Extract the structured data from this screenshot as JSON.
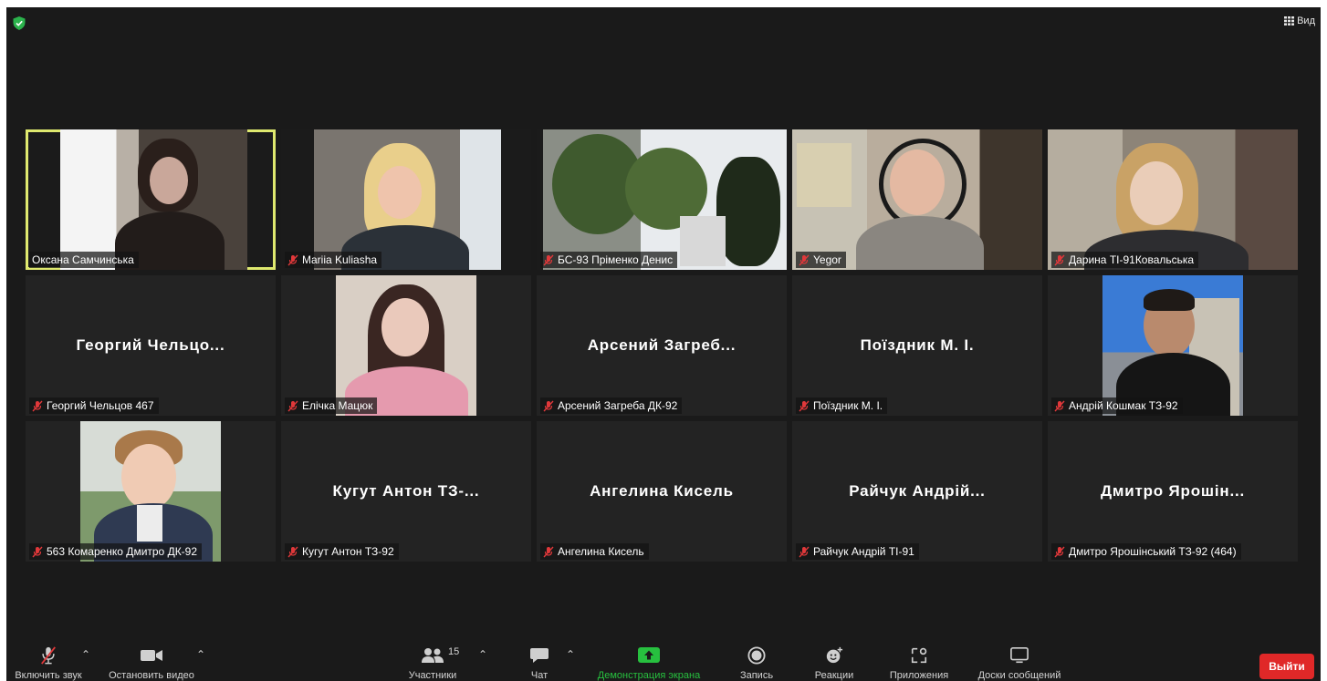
{
  "top": {
    "view_label": "Вид"
  },
  "tiles": [
    {
      "name": "Оксана Самчинська",
      "center": ""
    },
    {
      "name": "Mariia Kuliasha",
      "center": ""
    },
    {
      "name": "БС-93 Пріменко Денис",
      "center": ""
    },
    {
      "name": "Yegor",
      "center": ""
    },
    {
      "name": "Дарина ТІ-91Ковальська",
      "center": ""
    },
    {
      "name": "Георгий Чельцов 467",
      "center": "Георгий Чельцо..."
    },
    {
      "name": "Елічка Мацюк",
      "center": ""
    },
    {
      "name": "Арсений Загреба ДК-92",
      "center": "Арсений Загреб..."
    },
    {
      "name": "Поїздник М. І.",
      "center": "Поїздник М. І."
    },
    {
      "name": "Андрій Кошмак ТЗ-92",
      "center": ""
    },
    {
      "name": "563 Комаренко Дмитро ДК-92",
      "center": ""
    },
    {
      "name": "Кугут Антон ТЗ-92",
      "center": "Кугут Антон ТЗ-..."
    },
    {
      "name": "Ангелина Кисель",
      "center": "Ангелина Кисель"
    },
    {
      "name": "Райчук Андрій ТІ-91",
      "center": "Райчук Андрій..."
    },
    {
      "name": "Дмитро Ярошінський ТЗ-92 (464)",
      "center": "Дмитро Ярошін..."
    }
  ],
  "toolbar": {
    "mic_label": "Включить звук",
    "video_label": "Остановить видео",
    "participants_label": "Участники",
    "participants_count": "15",
    "chat_label": "Чат",
    "share_label": "Демонстрация экрана",
    "record_label": "Запись",
    "reactions_label": "Реакции",
    "apps_label": "Приложения",
    "whiteboard_label": "Доски сообщений",
    "leave_label": "Выйти"
  },
  "colors": {
    "accent_green": "#27c03f",
    "leave_red": "#e02828",
    "active_border": "#dfe96f",
    "mute_red": "#e0383a"
  }
}
